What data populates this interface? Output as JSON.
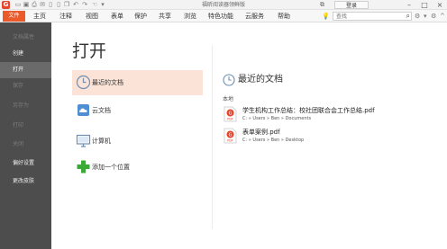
{
  "window": {
    "title": "福昕阅读器领鲜版",
    "login_label": "登录"
  },
  "menubar": {
    "file_tab": "文件",
    "items": [
      "主页",
      "注释",
      "视图",
      "表单",
      "保护",
      "共享",
      "浏览",
      "特色功能",
      "云服务",
      "帮助"
    ],
    "search_placeholder": "查找"
  },
  "sidebar": {
    "items": [
      {
        "label": "文档属性",
        "state": "disabled"
      },
      {
        "label": "创建",
        "state": "normal"
      },
      {
        "label": "打开",
        "state": "active"
      },
      {
        "label": "保存",
        "state": "disabled"
      },
      {
        "label": "另存为",
        "state": "disabled"
      },
      {
        "label": "打印",
        "state": "disabled"
      },
      {
        "label": "关闭",
        "state": "disabled"
      },
      {
        "label": "偏好设置",
        "state": "normal"
      },
      {
        "label": "更改皮肤",
        "state": "normal"
      }
    ]
  },
  "open_panel": {
    "title": "打开",
    "locations": [
      {
        "label": "最近的文档",
        "icon": "clock-icon",
        "selected": true
      },
      {
        "label": "云文档",
        "icon": "cloud-icon",
        "selected": false
      },
      {
        "label": "计算机",
        "icon": "computer-icon",
        "selected": false
      },
      {
        "label": "添加一个位置",
        "icon": "plus-icon",
        "selected": false
      }
    ]
  },
  "recent": {
    "title": "最近的文档",
    "group_label": "本地",
    "files": [
      {
        "name": "学生机构工作总结：校社团联合会工作总结.pdf",
        "path": "C: » Users » Ben » Documents"
      },
      {
        "name": "表单案例.pdf",
        "path": "C: » Users » Ben » Desktop"
      }
    ]
  },
  "colors": {
    "accent": "#ea5a2b",
    "sidebar_bg": "#4d4d4d",
    "selected_bg": "#fbe3d7",
    "plus_green": "#3aa935",
    "icon_blue": "#6d8fb3"
  }
}
